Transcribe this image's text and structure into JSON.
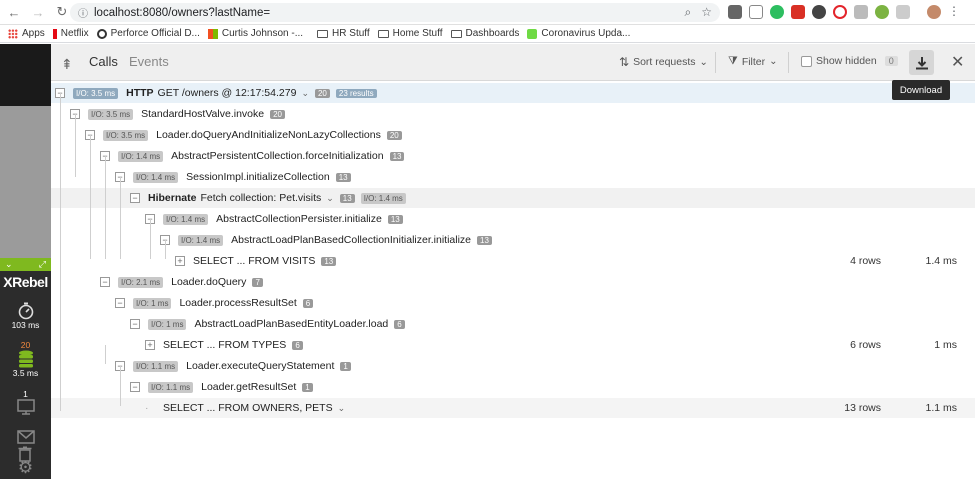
{
  "browser": {
    "url": "localhost:8080/owners?lastName=",
    "bookmarks": [
      {
        "label": "Apps",
        "icon": "apps-grid-icon"
      },
      {
        "label": "Netflix",
        "icon": "netflix-icon"
      },
      {
        "label": "Perforce Official D...",
        "icon": "perforce-icon"
      },
      {
        "label": "Curtis Johnson -...",
        "icon": "windows-icon"
      },
      {
        "label": "HR Stuff",
        "icon": "folder-icon"
      },
      {
        "label": "Home Stuff",
        "icon": "folder-icon"
      },
      {
        "label": "Dashboards",
        "icon": "folder-icon"
      },
      {
        "label": "Coronavirus Upda...",
        "icon": "upwork-icon"
      }
    ]
  },
  "sidebar": {
    "brand": "XRebel",
    "timer_value": "103 ms",
    "db_count": "20",
    "db_time": "3.5 ms",
    "exceptions_count": "1"
  },
  "toolbar": {
    "tab_calls": "Calls",
    "tab_events": "Events",
    "sort_label": "Sort requests",
    "filter_label": "Filter",
    "show_hidden_label": "Show hidden",
    "hidden_count": "0",
    "download_tooltip": "Download"
  },
  "tree": [
    {
      "io": "I/O: 3.5 ms",
      "bold": "HTTP",
      "label": "GET /owners @ 12:17:54.279",
      "count": "20",
      "extra": "23 results",
      "toggle": "−",
      "caret": "⌄"
    },
    {
      "io": "I/O: 3.5 ms",
      "label": "StandardHostValve.invoke",
      "count": "20",
      "toggle": "−"
    },
    {
      "io": "I/O: 3.5 ms",
      "label": "Loader.doQueryAndInitializeNonLazyCollections",
      "count": "20",
      "toggle": "−"
    },
    {
      "io": "I/O: 1.4 ms",
      "label": "AbstractPersistentCollection.forceInitialization",
      "count": "13",
      "toggle": "−"
    },
    {
      "io": "I/O: 1.4 ms",
      "label": "SessionImpl.initializeCollection",
      "count": "13",
      "toggle": "−"
    },
    {
      "bold": "Hibernate",
      "label": "Fetch collection: Pet.visits",
      "count": "13",
      "io_after": "I/O: 1.4 ms",
      "toggle": "−",
      "caret": "⌄"
    },
    {
      "io": "I/O: 1.4 ms",
      "label": "AbstractCollectionPersister.initialize",
      "count": "13",
      "toggle": "−"
    },
    {
      "io": "I/O: 1.4 ms",
      "label": "AbstractLoadPlanBasedCollectionInitializer.initialize",
      "count": "13",
      "toggle": "−"
    },
    {
      "label": "SELECT ... FROM VISITS",
      "count": "13",
      "rows": "4 rows",
      "ms": "1.4 ms",
      "toggle": "+"
    },
    {
      "io": "I/O: 2.1 ms",
      "label": "Loader.doQuery",
      "count": "7",
      "toggle": "−"
    },
    {
      "io": "I/O: 1 ms",
      "label": "Loader.processResultSet",
      "count": "6",
      "toggle": "−"
    },
    {
      "io": "I/O: 1 ms",
      "label": "AbstractLoadPlanBasedEntityLoader.load",
      "count": "6",
      "toggle": "−"
    },
    {
      "label": "SELECT ... FROM TYPES",
      "count": "6",
      "rows": "6 rows",
      "ms": "1 ms",
      "toggle": "+"
    },
    {
      "io": "I/O: 1.1 ms",
      "label": "Loader.executeQueryStatement",
      "count": "1",
      "toggle": "−"
    },
    {
      "io": "I/O: 1.1 ms",
      "label": "Loader.getResultSet",
      "count": "1",
      "toggle": "−"
    },
    {
      "label": "SELECT ... FROM OWNERS, PETS",
      "rows": "13 rows",
      "ms": "1.1 ms",
      "caret": "⌄"
    }
  ]
}
